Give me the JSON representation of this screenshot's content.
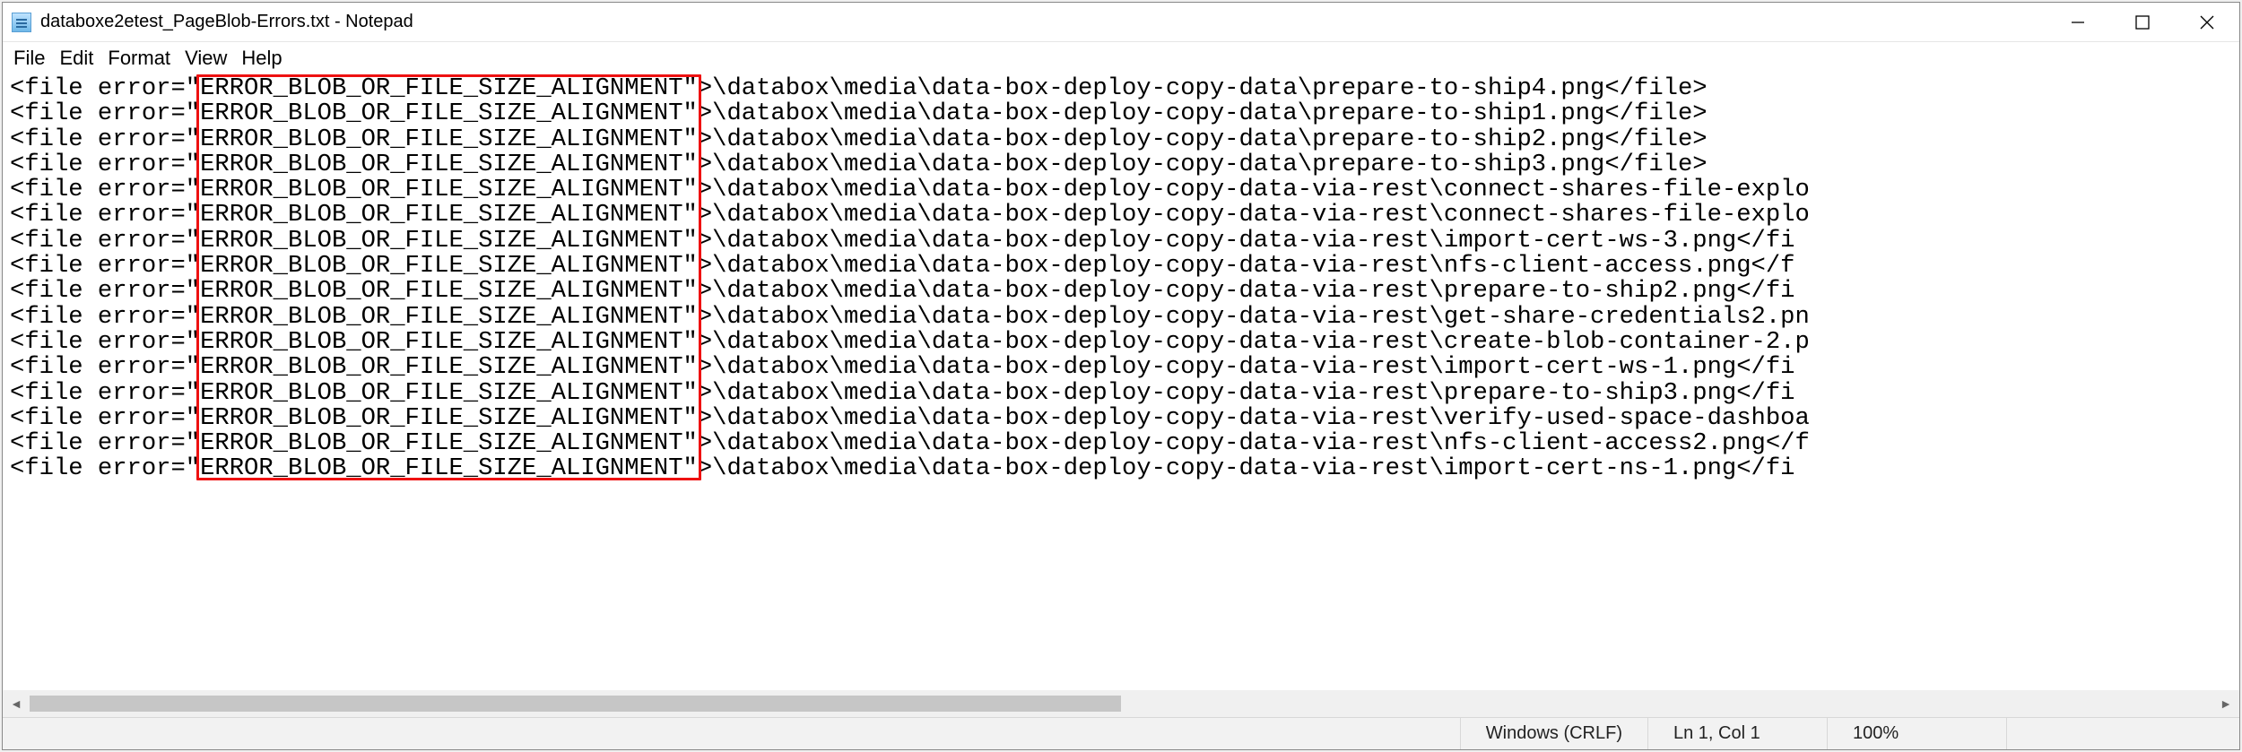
{
  "window": {
    "title": "databoxe2etest_PageBlob-Errors.txt - Notepad"
  },
  "menu": {
    "file": "File",
    "edit": "Edit",
    "format": "Format",
    "view": "View",
    "help": "Help"
  },
  "content": {
    "prefix": "<file error=\"",
    "error_code": "ERROR_BLOB_OR_FILE_SIZE_ALIGNMENT\"",
    "lines": [
      ">\\databox\\media\\data-box-deploy-copy-data\\prepare-to-ship4.png</file>",
      ">\\databox\\media\\data-box-deploy-copy-data\\prepare-to-ship1.png</file>",
      ">\\databox\\media\\data-box-deploy-copy-data\\prepare-to-ship2.png</file>",
      ">\\databox\\media\\data-box-deploy-copy-data\\prepare-to-ship3.png</file>",
      ">\\databox\\media\\data-box-deploy-copy-data-via-rest\\connect-shares-file-explo",
      ">\\databox\\media\\data-box-deploy-copy-data-via-rest\\connect-shares-file-explo",
      ">\\databox\\media\\data-box-deploy-copy-data-via-rest\\import-cert-ws-3.png</fi",
      ">\\databox\\media\\data-box-deploy-copy-data-via-rest\\nfs-client-access.png</f",
      ">\\databox\\media\\data-box-deploy-copy-data-via-rest\\prepare-to-ship2.png</fi",
      ">\\databox\\media\\data-box-deploy-copy-data-via-rest\\get-share-credentials2.pn",
      ">\\databox\\media\\data-box-deploy-copy-data-via-rest\\create-blob-container-2.p",
      ">\\databox\\media\\data-box-deploy-copy-data-via-rest\\import-cert-ws-1.png</fi",
      ">\\databox\\media\\data-box-deploy-copy-data-via-rest\\prepare-to-ship3.png</fi",
      ">\\databox\\media\\data-box-deploy-copy-data-via-rest\\verify-used-space-dashboa",
      ">\\databox\\media\\data-box-deploy-copy-data-via-rest\\nfs-client-access2.png</f",
      ">\\databox\\media\\data-box-deploy-copy-data-via-rest\\import-cert-ns-1.png</fi"
    ]
  },
  "status": {
    "encoding": "Windows (CRLF)",
    "position": "Ln 1, Col 1",
    "zoom": "100%"
  }
}
